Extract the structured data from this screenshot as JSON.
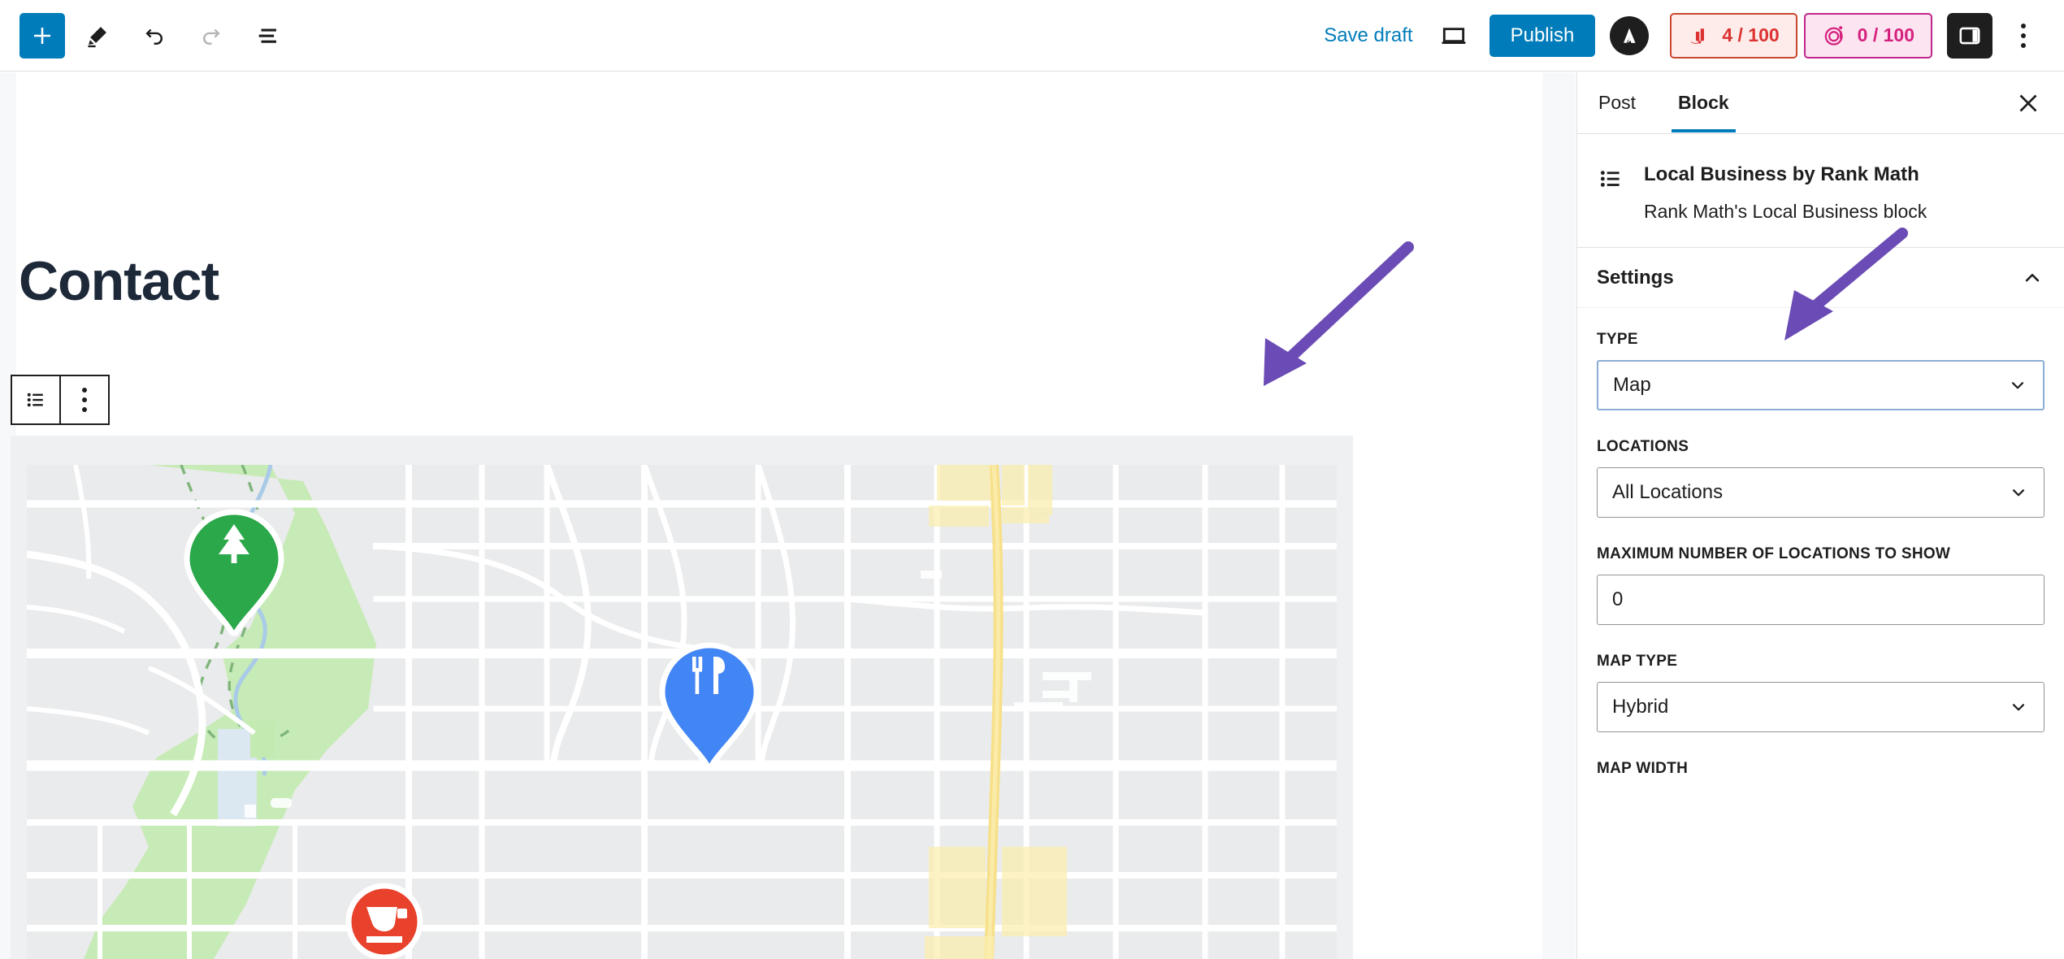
{
  "toolbar": {
    "inserter_label": "Add block",
    "tools_label": "Tools",
    "undo_label": "Undo",
    "redo_label": "Redo",
    "list_view_label": "Document Overview",
    "save_draft_label": "Save draft",
    "preview_label": "Preview",
    "publish_label": "Publish",
    "avatar_letter": "A",
    "seo_score": "4 / 100",
    "ai_score": "0 / 100",
    "sidebar_toggle_label": "Settings",
    "options_label": "Options"
  },
  "editor": {
    "post_title": "Contact",
    "block_toolbar": {
      "block_type_label": "Local Business",
      "more_options_label": "Options"
    },
    "map": {
      "markers": [
        {
          "name": "park-marker",
          "icon": "tree-icon",
          "color": "#2aa84a"
        },
        {
          "name": "restaurant-marker",
          "icon": "fork-knife-icon",
          "color": "#4285f4"
        },
        {
          "name": "cafe-marker",
          "icon": "coffee-cup-icon",
          "color": "#e8412c"
        }
      ],
      "colors": {
        "land": "#eaebec",
        "road": "#ffffff",
        "highway": "#f7e08a",
        "park": "#c3eab1",
        "water": "#a9cbe8"
      }
    }
  },
  "sidebar": {
    "tabs": [
      {
        "label": "Post",
        "active": false
      },
      {
        "label": "Block",
        "active": true
      }
    ],
    "close_label": "Close settings",
    "block": {
      "title": "Local Business by Rank Math",
      "description": "Rank Math's Local Business block",
      "icon": "list-icon"
    },
    "settings": {
      "title": "Settings",
      "collapsed": false,
      "fields": [
        {
          "name": "type",
          "label": "TYPE",
          "control": "select",
          "value": "Map",
          "focused": true
        },
        {
          "name": "locations",
          "label": "LOCATIONS",
          "control": "select",
          "value": "All Locations",
          "focused": false
        },
        {
          "name": "maximum-number-of-locations-to-show",
          "label": "MAXIMUM NUMBER OF LOCATIONS TO SHOW",
          "control": "text",
          "value": "0",
          "focused": false
        },
        {
          "name": "map-type",
          "label": "MAP TYPE",
          "control": "select",
          "value": "Hybrid",
          "focused": false
        },
        {
          "name": "map-width",
          "label": "MAP WIDTH",
          "control": "none",
          "value": "",
          "focused": false
        }
      ]
    }
  },
  "annotations": {
    "color": "#6b4bb5",
    "arrow_canvas_label": "points at block area",
    "arrow_type_label": "points at Type select"
  },
  "colors": {
    "accent_blue": "#007cba",
    "seo_red": "#dc3232",
    "ai_pink": "#d6227f",
    "dark": "#1e1e1e",
    "canvas_bg": "#f7f8f9",
    "annotation_purple": "#6b4bb5"
  }
}
